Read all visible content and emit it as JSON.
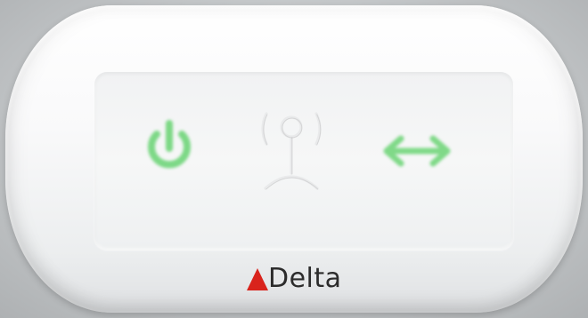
{
  "device": {
    "brand": {
      "name": "Delta",
      "mark_icon": "delta-triangle-icon",
      "mark_color": "#d9231c"
    },
    "indicators": [
      {
        "name": "power",
        "icon": "power-icon",
        "state": "on",
        "color": "#5fd16a"
      },
      {
        "name": "wireless",
        "icon": "wireless-antenna-icon",
        "state": "off",
        "color": "#e6e7e8"
      },
      {
        "name": "link",
        "icon": "bidirectional-arrow-icon",
        "state": "on",
        "color": "#5fd16a"
      }
    ]
  },
  "colors": {
    "body": "#f9f9fa",
    "background": "#c6c9cb"
  }
}
